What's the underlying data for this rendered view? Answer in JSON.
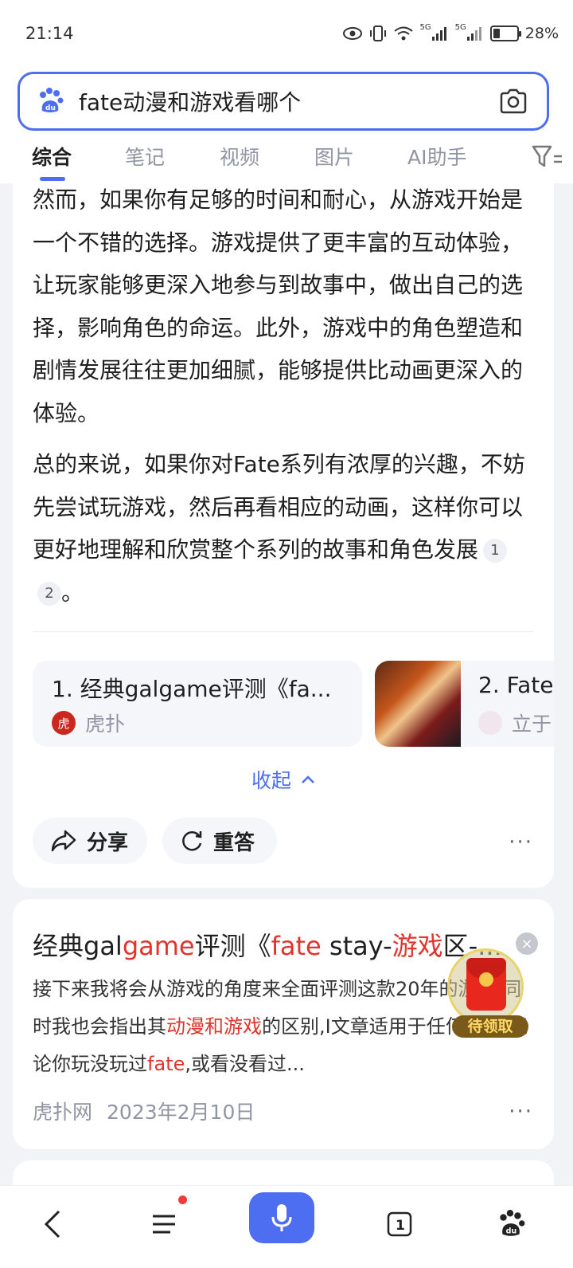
{
  "status_bar": {
    "time": "21:14",
    "network1": "5G",
    "network2": "5G",
    "battery": "28%",
    "battery_level": 0.28
  },
  "search": {
    "query": "fate动漫和游戏看哪个"
  },
  "tabs": [
    {
      "label": "综合",
      "active": true
    },
    {
      "label": "笔记",
      "active": false
    },
    {
      "label": "视频",
      "active": false
    },
    {
      "label": "图片",
      "active": false
    },
    {
      "label": "AI助手",
      "active": false
    }
  ],
  "answer": {
    "paragraph1": "然而，如果你有足够的时间和耐心，从游戏开始是一个不错的选择。游戏提供了更丰富的互动体验，让玩家能够更深入地参与到故事中，做出自己的选择，影响角色的命运。此外，游戏中的角色塑造和剧情发展往往更加细腻，能够提供比动画更深入的体验。",
    "paragraph2": "总的来说，如果你对Fate系列有浓厚的兴趣，不妨先尝试玩游戏，然后再看相应的动画，这样你可以更好地理解和欣赏整个系列的故事和角色发展",
    "paragraph2_end": "。",
    "refs": [
      "1",
      "2"
    ],
    "sources": [
      {
        "title": "1. 经典galgame评测《fa...",
        "site": "虎扑",
        "avatar_text": "虎扑"
      },
      {
        "title": "2. Fate",
        "site": "立于"
      }
    ],
    "collapse_label": "收起",
    "share_label": "分享",
    "redo_label": "重答",
    "more": "···"
  },
  "result": {
    "title_parts": [
      "经典gal",
      "game",
      "评测《",
      "fate",
      " stay-",
      "游戏",
      "区-..."
    ],
    "abstract_parts": [
      "接下来我将会从游戏的角度来全面评测这款20",
      "年",
      "的游戏,同时我也会指出其",
      "动漫和游戏",
      "的区别,I",
      "文",
      "章适用于任何人群,无论你玩没玩过",
      "fate",
      ",或看没看过..."
    ],
    "site": "虎扑网",
    "date": "2023年2月10日",
    "more": "···",
    "close": "×"
  },
  "red_packet": {
    "label": "待领取",
    "coin": "¥"
  },
  "bottom_nav": {
    "tabs_count": "1"
  },
  "colors": {
    "accent": "#4e6ef2",
    "highlight": "#e0342c"
  }
}
